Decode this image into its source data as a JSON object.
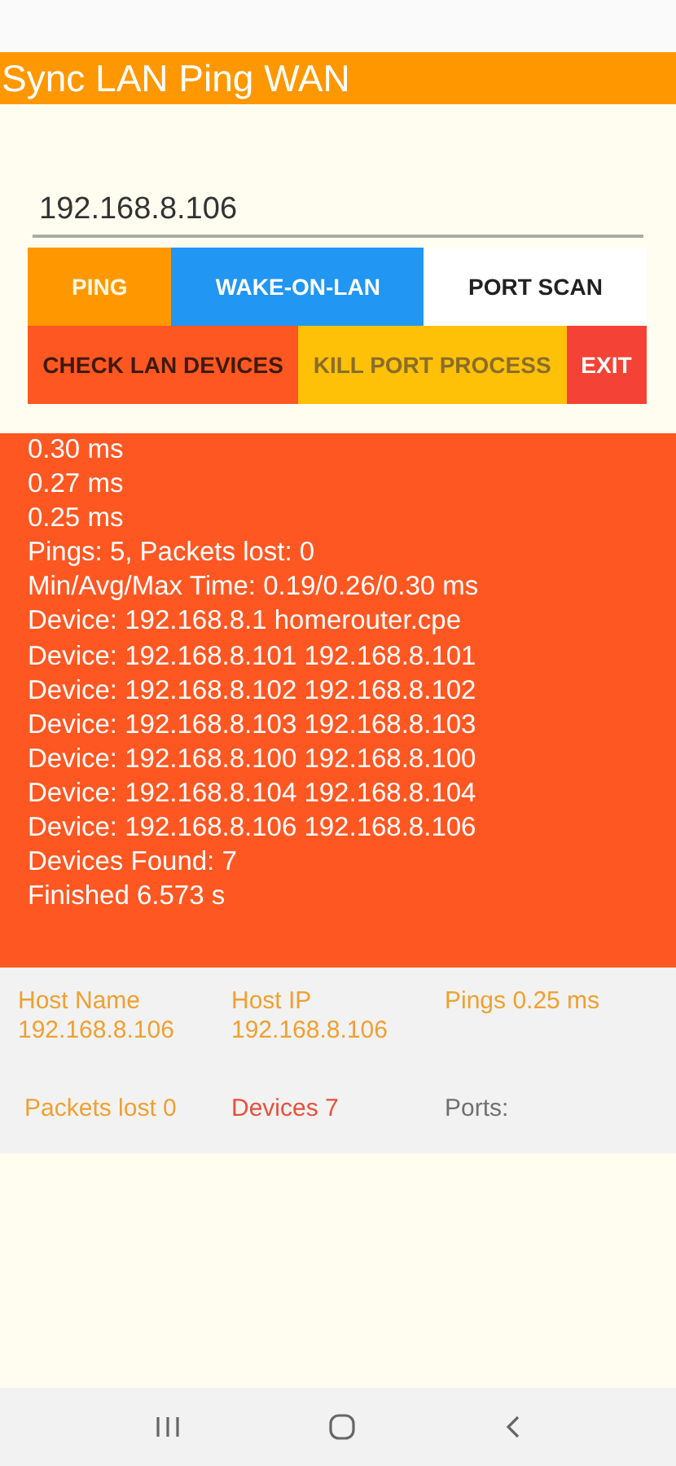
{
  "app_bar": {
    "title": "Sync LAN Ping WAN"
  },
  "address_field": {
    "value": "192.168.8.106"
  },
  "button_rows": [
    [
      {
        "label": "PING",
        "color": "#ff9800"
      },
      {
        "label": "WAKE-ON-LAN",
        "color": "#2196f3"
      },
      {
        "label": "PORT SCAN",
        "color": "#ffffff"
      }
    ],
    [
      {
        "label": "CHECK LAN DEVICES",
        "color": "#ff5722"
      },
      {
        "label": "KILL PORT PROCESS",
        "color": "#ffc107"
      },
      {
        "label": "EXIT",
        "color": "#f44336"
      }
    ]
  ],
  "log_lines": [
    "0.30 ms",
    "0.27 ms",
    "0.25 ms",
    "Pings: 5, Packets lost: 0",
    "Min/Avg/Max Time: 0.19/0.26/0.30 ms",
    "Device: 192.168.8.1 homerouter.cpe",
    "Device: 192.168.8.101 192.168.8.101",
    "Device: 192.168.8.102 192.168.8.102",
    "Device: 192.168.8.103 192.168.8.103",
    "Device: 192.168.8.100 192.168.8.100",
    "Device: 192.168.8.104 192.168.8.104",
    "Device: 192.168.8.106 192.168.8.106",
    "Devices Found: 7",
    "Finished 6.573 s"
  ],
  "info_items": [
    {
      "label": "Host Name",
      "value": "192.168.8.106",
      "color": "#f0a030"
    },
    {
      "label": "Host IP",
      "value": "192.168.8.106",
      "color": "#f0a030"
    },
    {
      "label": "Pings 0.25 ms",
      "color": "#f0a030"
    },
    {
      "label": "Packets lost 0",
      "color": "#f0a030"
    },
    {
      "label": "Devices 7",
      "color": "#e8503a"
    },
    {
      "label": "Ports:",
      "color": "#707070"
    }
  ]
}
